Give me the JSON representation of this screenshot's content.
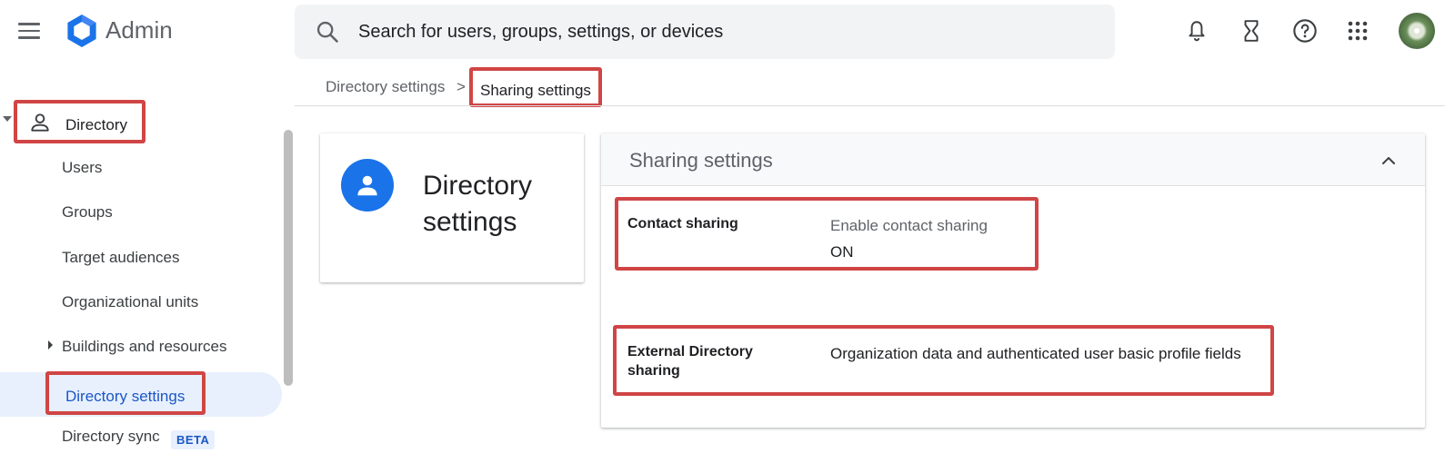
{
  "header": {
    "app_title": "Admin",
    "search_placeholder": "Search for users, groups, settings, or devices",
    "icons": [
      "menu-icon",
      "admin-logo",
      "search-icon",
      "notifications-icon",
      "tasks-hourglass-icon",
      "help-icon",
      "apps-grid-icon",
      "account-avatar"
    ]
  },
  "sidebar": {
    "section_label": "Directory",
    "items": [
      {
        "label": "Users"
      },
      {
        "label": "Groups"
      },
      {
        "label": "Target audiences"
      },
      {
        "label": "Organizational units"
      },
      {
        "label": "Buildings and resources"
      },
      {
        "label": "Directory settings"
      },
      {
        "label": "Directory sync"
      }
    ],
    "beta_badge": "BETA"
  },
  "breadcrumb": {
    "parent": "Directory settings",
    "separator": ">",
    "current": "Sharing settings"
  },
  "summary_card": {
    "title": "Directory settings"
  },
  "settings_panel": {
    "title": "Sharing settings",
    "rows": [
      {
        "label": "Contact sharing",
        "sublabel": "Enable contact sharing",
        "value": "ON"
      },
      {
        "label": "External Directory sharing",
        "value": "Organization data and authenticated user basic profile fields"
      }
    ]
  },
  "colors": {
    "accent_blue": "#1a73e8",
    "active_nav_bg": "#e8f0fe",
    "annotation_red": "#d04545"
  }
}
